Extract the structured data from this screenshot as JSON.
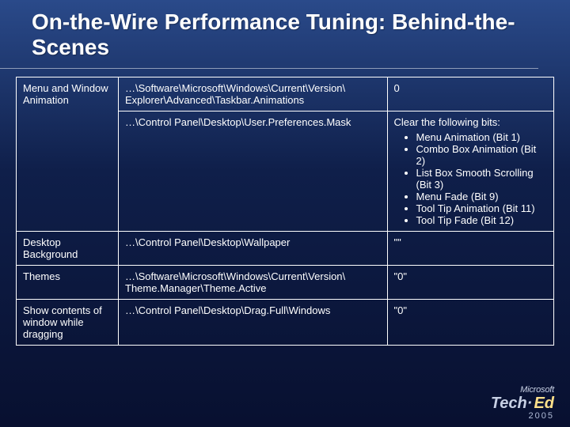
{
  "title": "On-the-Wire Performance Tuning: Behind-the-Scenes",
  "rows": {
    "r1": {
      "label": "Menu and Window Animation",
      "path": "…\\Software\\Microsoft\\Windows\\Current\\Version\\ Explorer\\Advanced\\Taskbar.Animations",
      "value": "0"
    },
    "r2": {
      "path": "…\\Control Panel\\Desktop\\User.Preferences.Mask",
      "value_heading": "Clear the following bits:",
      "bits": {
        "b1": "Menu Animation (Bit 1)",
        "b2": "Combo Box Animation (Bit 2)",
        "b3": "List Box Smooth Scrolling (Bit 3)",
        "b4": "Menu Fade (Bit 9)",
        "b5": "Tool Tip Animation (Bit 11)",
        "b6": "Tool Tip Fade (Bit 12)"
      }
    },
    "r3": {
      "label": "Desktop Background",
      "path": "…\\Control Panel\\Desktop\\Wallpaper",
      "value": "\"\""
    },
    "r4": {
      "label": "Themes",
      "path": "…\\Software\\Microsoft\\Windows\\Current\\Version\\ Theme.Manager\\Theme.Active",
      "value": "\"0\""
    },
    "r5": {
      "label": "Show contents of window while dragging",
      "path": "…\\Control Panel\\Desktop\\Drag.Full\\Windows",
      "value": "\"0\""
    }
  },
  "footer": {
    "brand_ms": "Microsoft",
    "brand_tech": "Tech·",
    "brand_ed": "Ed",
    "year": "2005"
  }
}
